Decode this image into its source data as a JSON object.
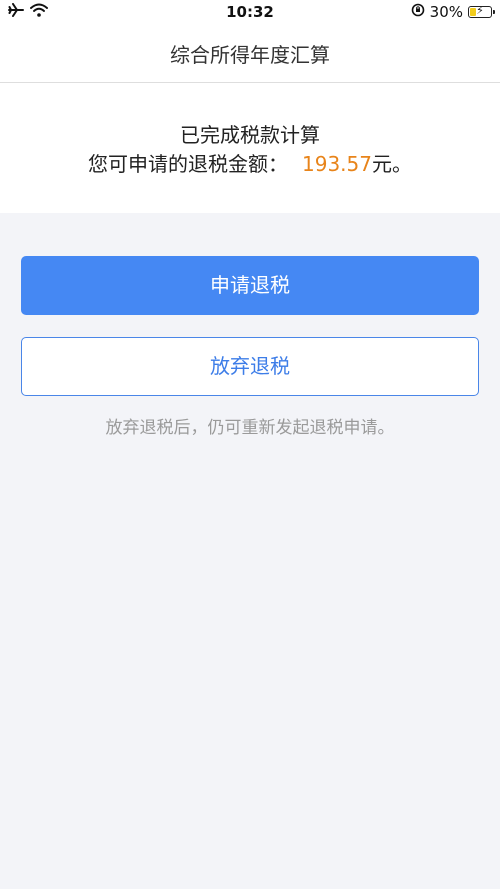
{
  "status_bar": {
    "time": "10:32",
    "battery": "30%",
    "battery_level": 0.3,
    "icons": [
      "airplane-icon",
      "wifi-icon",
      "orientation-lock-icon",
      "battery-icon"
    ]
  },
  "nav": {
    "title": "综合所得年度汇算"
  },
  "result": {
    "line1": "已完成税款计算",
    "line2_prefix": "您可申请的退税金额：",
    "amount": "193.57",
    "amount_suffix": "元。",
    "amount_color": "#e8841a"
  },
  "actions": {
    "apply_label": "申请退税",
    "abandon_label": "放弃退税",
    "hint": "放弃退税后，仍可重新发起退税申请。"
  },
  "colors": {
    "primary": "#4588f3",
    "background": "#f3f4f8"
  }
}
